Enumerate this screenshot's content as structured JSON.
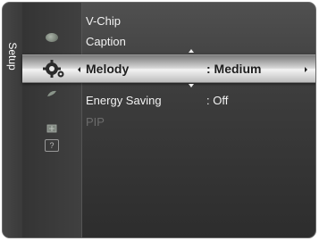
{
  "sidebar": {
    "label": "Setup"
  },
  "icons": [
    "disc-icon",
    "gear-icon",
    "leaf-icon",
    "box-icon",
    "help-icon"
  ],
  "help_icon_text": "?",
  "menu": {
    "items": [
      {
        "label": "V-Chip"
      },
      {
        "label": "Caption"
      },
      {
        "label": "Melody",
        "value": ": Medium",
        "selected": true
      },
      {
        "label": "Energy Saving",
        "value": ": Off"
      },
      {
        "label": "PIP",
        "disabled": true
      }
    ]
  },
  "colors": {
    "background": "#3c3c3c",
    "highlight": "#e6e6e6",
    "text": "#f2f2f2",
    "selected_text": "#1d1d1d",
    "disabled_text": "#6c6c6c"
  }
}
